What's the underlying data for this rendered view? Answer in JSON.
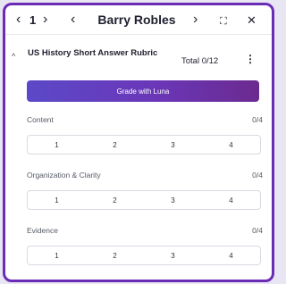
{
  "nav": {
    "prev_icon": "‹",
    "page_number": "1",
    "next_icon": "›",
    "prev_student_icon": "‹",
    "student_name": "Barry Robles",
    "next_student_icon": "›",
    "expand_icon": "⛶",
    "close_icon": "✕"
  },
  "rubric": {
    "collapse_icon": "^",
    "title": "US History Short Answer Rubric",
    "total": "Total 0/12",
    "more_icon": "⋮",
    "grade_button": "Grade with Luna",
    "criteria": [
      {
        "label": "Content",
        "score": "0/4",
        "options": [
          "1",
          "2",
          "3",
          "4"
        ]
      },
      {
        "label": "Organization & Clarity",
        "score": "0/4",
        "options": [
          "1",
          "2",
          "3",
          "4"
        ]
      },
      {
        "label": "Evidence",
        "score": "0/4",
        "options": [
          "1",
          "2",
          "3",
          "4"
        ]
      }
    ]
  },
  "colors": {
    "frame_border": "#6a2bb5",
    "button_gradient_start": "#5b49c8",
    "button_gradient_end": "#6b2a8f"
  }
}
